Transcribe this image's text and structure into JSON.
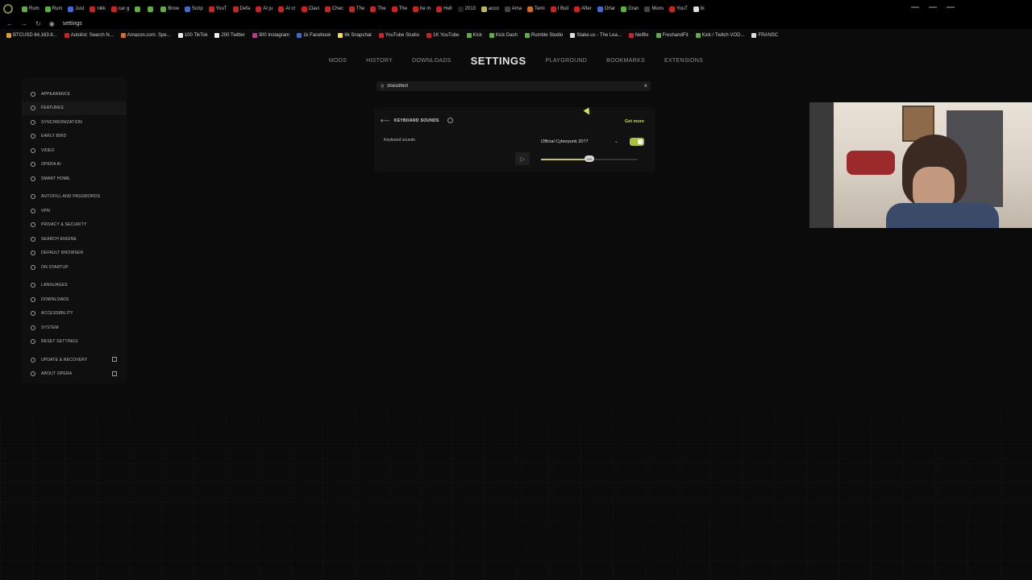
{
  "tabs": [
    {
      "label": "Rum",
      "color": "#59b23b"
    },
    {
      "label": "Rum",
      "color": "#59b23b"
    },
    {
      "label": "Just",
      "color": "#3d6bd6"
    },
    {
      "label": "nikk",
      "color": "#cc2222"
    },
    {
      "label": "car g",
      "color": "#cc2222"
    },
    {
      "label": "",
      "color": "#59b23b"
    },
    {
      "label": "",
      "color": "#59b23b"
    },
    {
      "label": "Brow",
      "color": "#59b23b"
    },
    {
      "label": "Scrip",
      "color": "#3d6bd6"
    },
    {
      "label": "YouT",
      "color": "#cc2222"
    },
    {
      "label": "Defa",
      "color": "#cc2222"
    },
    {
      "label": "AI ju",
      "color": "#cc2222"
    },
    {
      "label": "AI cr",
      "color": "#cc2222"
    },
    {
      "label": "Clavi",
      "color": "#cc2222"
    },
    {
      "label": "Chec",
      "color": "#cc2222"
    },
    {
      "label": "The",
      "color": "#cc2222"
    },
    {
      "label": "The",
      "color": "#cc2222"
    },
    {
      "label": "The",
      "color": "#cc2222"
    },
    {
      "label": "he m",
      "color": "#cc2222"
    },
    {
      "label": "Hell",
      "color": "#cc2222"
    },
    {
      "label": "2013",
      "color": "#222222"
    },
    {
      "label": "acco",
      "color": "#b9b94a"
    },
    {
      "label": "Ama",
      "color": "#444444"
    },
    {
      "label": "Temi",
      "color": "#d86a1e"
    },
    {
      "label": "I Buil",
      "color": "#cc2222"
    },
    {
      "label": "After",
      "color": "#cc2222"
    },
    {
      "label": "Orlar",
      "color": "#3d6bd6"
    },
    {
      "label": "Gran",
      "color": "#59b23b"
    },
    {
      "label": "Mons",
      "color": "#444444"
    },
    {
      "label": "YouT",
      "color": "#cc2222"
    },
    {
      "label": "bi",
      "color": "#dddddd"
    }
  ],
  "address": {
    "url": "settings"
  },
  "bookmarks": [
    {
      "label": "BTCUSD 64,163.8...",
      "color": "#e0a020"
    },
    {
      "label": "Autolist: Search N...",
      "color": "#cc2222"
    },
    {
      "label": "Amazon.com. Spe...",
      "color": "#d86a1e"
    },
    {
      "label": "100 TikTok",
      "color": "#eeeeee"
    },
    {
      "label": "200 Twitter",
      "color": "#eeeeee"
    },
    {
      "label": "300 Instagram",
      "color": "#c13584"
    },
    {
      "label": "1k Facebook",
      "color": "#3d6bd6"
    },
    {
      "label": "6k Snapchat",
      "color": "#f2e14a"
    },
    {
      "label": "YouTube Studio",
      "color": "#cc2222"
    },
    {
      "label": "1K YouTube",
      "color": "#cc2222"
    },
    {
      "label": "Kick",
      "color": "#59b23b"
    },
    {
      "label": "Kick Dash",
      "color": "#59b23b"
    },
    {
      "label": "Rumble Studio",
      "color": "#59b23b"
    },
    {
      "label": "Stake.us - The Lea...",
      "color": "#dddddd"
    },
    {
      "label": "Netflix",
      "color": "#cc2222"
    },
    {
      "label": "FreshandFit",
      "color": "#59b23b"
    },
    {
      "label": "Kick / Twitch VOD...",
      "color": "#59b23b"
    },
    {
      "label": "FRANSC",
      "color": "#dddddd"
    }
  ],
  "topnav": {
    "items": [
      "MODS",
      "HISTORY",
      "DOWNLOADS",
      "SETTINGS",
      "PLAYGROUND",
      "BOOKMARKS",
      "EXTENSIONS"
    ],
    "active": "SETTINGS"
  },
  "sidebar": {
    "items": [
      {
        "label": "APPEARANCE",
        "icon": "appearance-icon"
      },
      {
        "label": "FEATURES",
        "icon": "features-icon",
        "active": true
      },
      {
        "label": "SYNCHRONIZATION",
        "icon": "sync-icon"
      },
      {
        "label": "EARLY BIRD",
        "icon": "bird-icon"
      },
      {
        "label": "VIDEO",
        "icon": "video-icon"
      },
      {
        "label": "OPERA AI",
        "icon": "ai-icon"
      },
      {
        "label": "SMART HOME",
        "icon": "home-icon"
      },
      {
        "label": "AUTOFILL AND PASSWORDS",
        "icon": "key-icon",
        "gap": true
      },
      {
        "label": "VPN",
        "icon": "vpn-icon"
      },
      {
        "label": "PRIVACY & SECURITY",
        "icon": "shield-icon"
      },
      {
        "label": "SEARCH ENGINE",
        "icon": "search-icon"
      },
      {
        "label": "DEFAULT BROWSER",
        "icon": "browser-icon"
      },
      {
        "label": "ON STARTUP",
        "icon": "power-icon"
      },
      {
        "label": "LANGUAGES",
        "icon": "language-icon",
        "gap": true
      },
      {
        "label": "DOWNLOADS",
        "icon": "download-icon"
      },
      {
        "label": "ACCESSIBILITY",
        "icon": "accessibility-icon"
      },
      {
        "label": "SYSTEM",
        "icon": "system-icon"
      },
      {
        "label": "RESET SETTINGS",
        "icon": "reset-icon"
      },
      {
        "label": "UPDATE & RECOVERY",
        "icon": "update-icon",
        "gap": true,
        "external": true
      },
      {
        "label": "ABOUT OPERA",
        "icon": "opera-icon",
        "external": true
      }
    ]
  },
  "search": {
    "value": "dsesdfesf",
    "placeholder": ""
  },
  "keyboard_sounds": {
    "title": "KEYBOARD SOUNDS",
    "get_more": "Get more",
    "row_label": "Keyboard sounds",
    "selected_sound": "Official Cyberpunk 2077",
    "enabled": true,
    "volume": 100,
    "volume_fraction": 0.5
  },
  "colors": {
    "accent": "#c8e02a",
    "toggle": "#a8c23a",
    "background": "#0b0b0b"
  }
}
